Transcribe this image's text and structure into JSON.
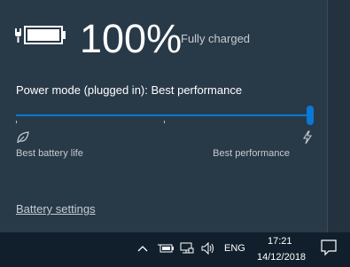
{
  "battery": {
    "icon": "battery-plugged-icon",
    "level_fraction": 1.0,
    "percent_text": "100%",
    "status_text": "Fully charged"
  },
  "power_mode": {
    "label": "Power mode (plugged in): Best performance",
    "slider_position_fraction": 1.0,
    "left_label": "Best battery life",
    "right_label": "Best performance",
    "left_icon": "leaf-icon",
    "right_icon": "lightning-bolt-icon",
    "accent_color": "#0a78d7"
  },
  "links": {
    "battery_settings": "Battery settings"
  },
  "taskbar": {
    "icons": [
      "chevron-up-icon",
      "battery-icon",
      "network-icon",
      "volume-icon",
      "action-center-icon"
    ],
    "language": "ENG",
    "time": "17:21",
    "date": "14/12/2018"
  }
}
